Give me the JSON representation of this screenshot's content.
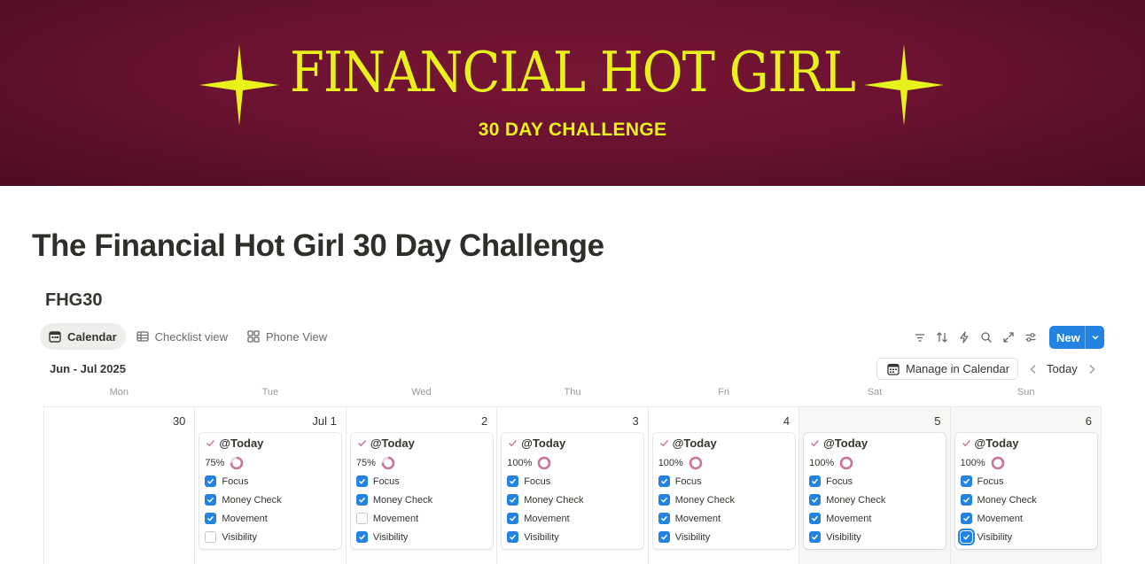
{
  "banner": {
    "title": "FINANCIAL HOT GIRL",
    "subtitle": "30 DAY CHALLENGE",
    "text_color": "#e8f21a",
    "bg_color": "#6a1230"
  },
  "page": {
    "title": "The Financial Hot Girl 30 Day Challenge"
  },
  "database": {
    "title": "FHG30",
    "views": [
      {
        "label": "Calendar",
        "icon": "calendar-icon",
        "active": true
      },
      {
        "label": "Checklist view",
        "icon": "table-icon",
        "active": false
      },
      {
        "label": "Phone View",
        "icon": "gallery-icon",
        "active": false
      }
    ],
    "toolbar": {
      "icons": [
        "filter-icon",
        "sort-icon",
        "automation-icon",
        "search-icon",
        "expand-icon",
        "settings-icon"
      ],
      "new_label": "New"
    },
    "month_label": "Jun - Jul 2025",
    "manage_label": "Manage in Calendar",
    "today_label": "Today",
    "weekdays": [
      "Mon",
      "Tue",
      "Wed",
      "Thu",
      "Fri",
      "Sat",
      "Sun"
    ],
    "days": [
      {
        "num": "30",
        "weekend": false,
        "card": null
      },
      {
        "num": "Jul 1",
        "weekend": false,
        "card": {
          "title": "@Today",
          "progress": "75%",
          "pct": 0.75,
          "items": [
            {
              "label": "Focus",
              "checked": true
            },
            {
              "label": "Money Check",
              "checked": true
            },
            {
              "label": "Movement",
              "checked": true
            },
            {
              "label": "Visibility",
              "checked": false
            }
          ]
        }
      },
      {
        "num": "2",
        "weekend": false,
        "card": {
          "title": "@Today",
          "progress": "75%",
          "pct": 0.75,
          "items": [
            {
              "label": "Focus",
              "checked": true
            },
            {
              "label": "Money Check",
              "checked": true
            },
            {
              "label": "Movement",
              "checked": false
            },
            {
              "label": "Visibility",
              "checked": true
            }
          ]
        }
      },
      {
        "num": "3",
        "weekend": false,
        "card": {
          "title": "@Today",
          "progress": "100%",
          "pct": 1.0,
          "items": [
            {
              "label": "Focus",
              "checked": true
            },
            {
              "label": "Money Check",
              "checked": true
            },
            {
              "label": "Movement",
              "checked": true
            },
            {
              "label": "Visibility",
              "checked": true
            }
          ]
        }
      },
      {
        "num": "4",
        "weekend": false,
        "card": {
          "title": "@Today",
          "progress": "100%",
          "pct": 1.0,
          "items": [
            {
              "label": "Focus",
              "checked": true
            },
            {
              "label": "Money Check",
              "checked": true
            },
            {
              "label": "Movement",
              "checked": true
            },
            {
              "label": "Visibility",
              "checked": true
            }
          ]
        }
      },
      {
        "num": "5",
        "weekend": true,
        "card": {
          "title": "@Today",
          "progress": "100%",
          "pct": 1.0,
          "items": [
            {
              "label": "Focus",
              "checked": true
            },
            {
              "label": "Money Check",
              "checked": true
            },
            {
              "label": "Movement",
              "checked": true
            },
            {
              "label": "Visibility",
              "checked": true
            }
          ]
        }
      },
      {
        "num": "6",
        "weekend": true,
        "card": {
          "title": "@Today",
          "progress": "100%",
          "pct": 1.0,
          "items": [
            {
              "label": "Focus",
              "checked": true
            },
            {
              "label": "Money Check",
              "checked": true
            },
            {
              "label": "Movement",
              "checked": true
            },
            {
              "label": "Visibility",
              "checked": true,
              "focused": true
            }
          ]
        }
      }
    ],
    "colors": {
      "accent": "#2383e2",
      "ring": "#c9759a",
      "check_mark": "#c9759a"
    }
  }
}
